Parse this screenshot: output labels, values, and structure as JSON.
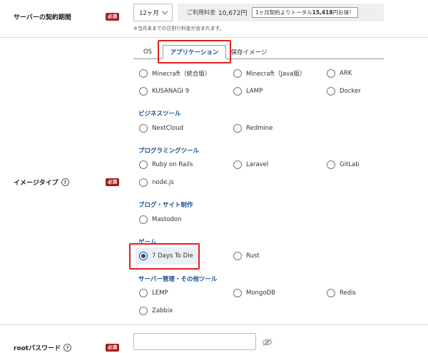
{
  "contract": {
    "label": "サーバーの契約期間",
    "required": "必須",
    "period": "12ヶ月",
    "fee_label": "ご利用料金",
    "fee_value": "10,672円",
    "discount_prefix": "1ヶ月契約よりトータル",
    "discount_amount": "15,418",
    "discount_suffix": "円お得！",
    "note": "※当月末までの日割り料金が含まれます。"
  },
  "image_type": {
    "label": "イメージタイプ",
    "required": "必須",
    "help": "?",
    "tabs": [
      "OS",
      "アプリケーション",
      "保存イメージ"
    ],
    "active_tab": "アプリケーション",
    "apps": [
      "Minecraft（統合版）",
      "Minecraft（Java版）",
      "ARK",
      "KUSANAGI 9",
      "LAMP",
      "Docker"
    ],
    "categories": {
      "business": {
        "title": "ビジネスツール",
        "items": [
          "NextCloud",
          "Redmine"
        ]
      },
      "programming": {
        "title": "プログラミングツール",
        "items": [
          "Ruby on Rails",
          "Laravel",
          "GitLab",
          "node.js"
        ]
      },
      "blog": {
        "title": "ブログ・サイト制作",
        "items": [
          "Mastodon"
        ]
      },
      "game": {
        "title": "ゲーム",
        "items": [
          "7 Days To Die",
          "Rust"
        ]
      },
      "server": {
        "title": "サーバー管理・その他ツール",
        "items": [
          "LEMP",
          "MongoDB",
          "Redis",
          "Zabbix"
        ]
      }
    },
    "selected": "7 Days To Die"
  },
  "root_password": {
    "label": "rootパスワード",
    "required": "必須",
    "help": "?",
    "value": ""
  },
  "icons": {
    "select_chevron": "chevron-down-icon",
    "password_visibility": "eye-slash-icon",
    "help": "help-icon"
  },
  "colors": {
    "required_badge": "#a31d1d",
    "accent": "#1a4f8a",
    "highlight_box": "#e02020",
    "selected_bg": "#eaf0f6"
  }
}
